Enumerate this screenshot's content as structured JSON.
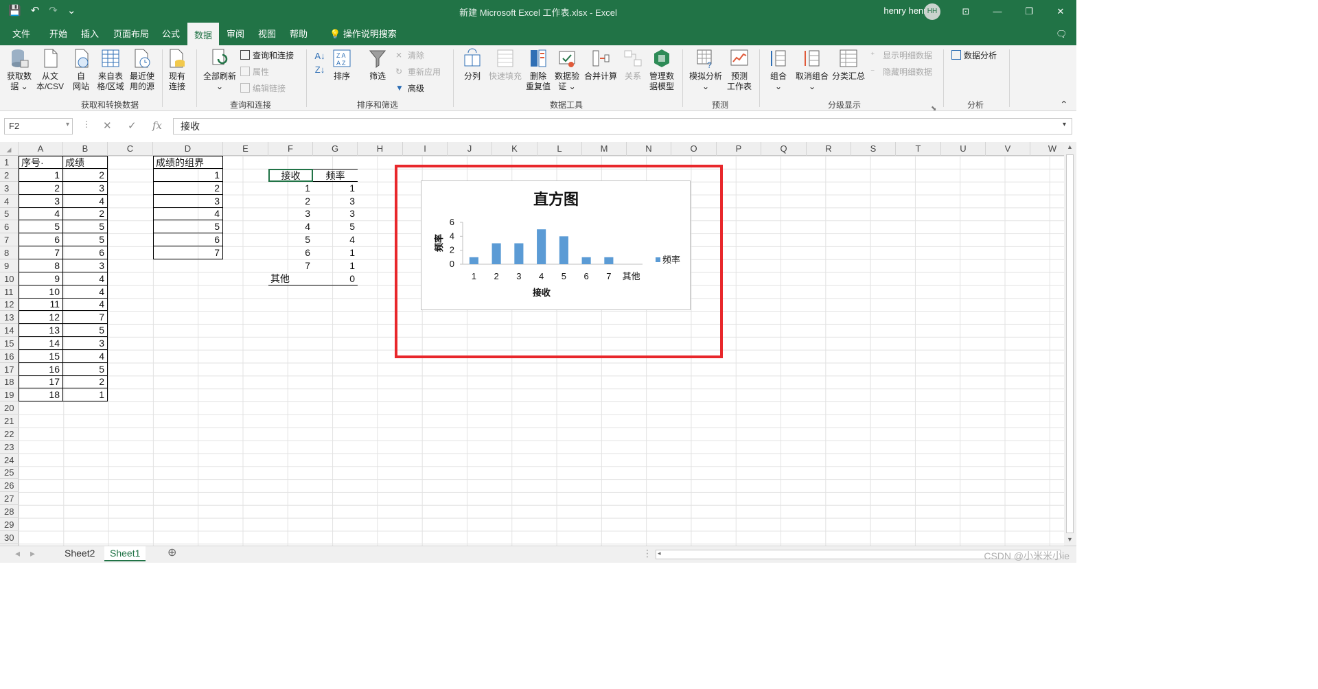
{
  "window": {
    "title": "新建 Microsoft Excel 工作表.xlsx  -  Excel",
    "user": "henry henry",
    "user_initials": "HH",
    "controls": [
      "⊡",
      "—",
      "❐",
      "✕"
    ],
    "accent_color": "#217346"
  },
  "quick_access": {
    "save": "💾",
    "undo": "↶",
    "redo": "↷",
    "customize": "⌄"
  },
  "tabs": [
    {
      "label": "文件"
    },
    {
      "label": "开始"
    },
    {
      "label": "插入"
    },
    {
      "label": "页面布局"
    },
    {
      "label": "公式"
    },
    {
      "label": "数据"
    },
    {
      "label": "审阅"
    },
    {
      "label": "视图"
    },
    {
      "label": "帮助"
    },
    {
      "label": "操作说明搜索"
    }
  ],
  "active_tab": "数据",
  "ribbon": {
    "get_data": {
      "label": "获取数\n据 ⌄"
    },
    "from_csv": {
      "label": "从文\n本/CSV"
    },
    "from_web": {
      "label": "自\n网站"
    },
    "from_table": {
      "label": "来自表\n格/区域"
    },
    "recent_sources": {
      "label": "最近使\n用的源"
    },
    "existing_conn": {
      "label": "现有\n连接"
    },
    "group_get": "获取和转换数据",
    "refresh_all": {
      "label": "全部刷新\n⌄"
    },
    "queries_conn": "查询和连接",
    "properties": "属性",
    "edit_links": "编辑链接",
    "group_queries": "查询和连接",
    "sort": "排序",
    "filter": "筛选",
    "clear": "清除",
    "reapply": "重新应用",
    "advanced": "高级",
    "group_sort": "排序和筛选",
    "text_to_columns": "分列",
    "flash_fill": "快速填充",
    "remove_dup": "删除\n重复值",
    "data_validation": "数据验\n证 ⌄",
    "consolidate": "合并计算",
    "relationships": "关系",
    "data_model": "管理数\n据模型",
    "group_tools": "数据工具",
    "what_if": "模拟分析\n⌄",
    "forecast_sheet": "预测\n工作表",
    "group_forecast": "预测",
    "group_btn": "组合\n⌄",
    "ungroup": "取消组合\n⌄",
    "subtotal": "分类汇总",
    "show_detail": "显示明细数据",
    "hide_detail": "隐藏明细数据",
    "group_outline": "分级显示",
    "data_analysis": "数据分析",
    "group_analysis": "分析"
  },
  "formula_bar": {
    "name_box": "F2",
    "cancel": "✕",
    "enter": "✓",
    "fx": "fx",
    "formula": "接收"
  },
  "columns": [
    "A",
    "B",
    "C",
    "D",
    "E",
    "F",
    "G",
    "H",
    "I",
    "J",
    "K",
    "L",
    "M",
    "N",
    "O",
    "P",
    "Q",
    "R",
    "S",
    "T",
    "U",
    "V",
    "W"
  ],
  "rows": [
    "1",
    "2",
    "3",
    "4",
    "5",
    "6",
    "7",
    "8",
    "9",
    "10",
    "11",
    "12",
    "13",
    "14",
    "15",
    "16",
    "17",
    "18",
    "19",
    "20",
    "21",
    "22",
    "23",
    "24",
    "25",
    "26",
    "27",
    "28",
    "29",
    "30"
  ],
  "table_a": {
    "header_a": "序号·",
    "header_b": "成绩",
    "ids": [
      "1",
      "2",
      "3",
      "4",
      "5",
      "6",
      "7",
      "8",
      "9",
      "10",
      "11",
      "12",
      "13",
      "14",
      "15",
      "16",
      "17",
      "18"
    ],
    "scores": [
      "2",
      "3",
      "4",
      "2",
      "5",
      "5",
      "6",
      "3",
      "4",
      "4",
      "4",
      "7",
      "5",
      "3",
      "4",
      "5",
      "2",
      "1"
    ]
  },
  "table_d": {
    "header": "成绩的组界",
    "bins": [
      "1",
      "2",
      "3",
      "4",
      "5",
      "6",
      "7"
    ]
  },
  "table_fg": {
    "header_f": "接收",
    "header_g": "频率",
    "bins": [
      "1",
      "2",
      "3",
      "4",
      "5",
      "6",
      "7",
      "其他"
    ],
    "freqs": [
      "1",
      "3",
      "3",
      "5",
      "4",
      "1",
      "1",
      "0"
    ]
  },
  "chart_data": {
    "type": "bar",
    "title": "直方图",
    "xlabel": "接收",
    "ylabel": "频率",
    "categories": [
      "1",
      "2",
      "3",
      "4",
      "5",
      "6",
      "7",
      "其他"
    ],
    "series": [
      {
        "name": "频率",
        "values": [
          1,
          3,
          3,
          5,
          4,
          1,
          1,
          0
        ],
        "color": "#5b9bd5"
      }
    ],
    "yticks": [
      "0",
      "2",
      "4",
      "6"
    ],
    "ylim": [
      0,
      6
    ],
    "legend": "right",
    "grid": false
  },
  "highlight_color": "#e8272b",
  "sheet_tabs": [
    {
      "label": "Sheet2"
    },
    {
      "label": "Sheet1"
    }
  ],
  "active_sheet": "Sheet1",
  "add_sheet": "⊕",
  "watermark": "CSDN @小米米小ie"
}
